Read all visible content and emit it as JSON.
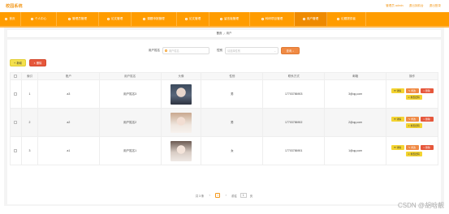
{
  "header": {
    "app_title": "校园系统",
    "links": [
      "管理员 admin",
      "退出到前台",
      "退出登录"
    ]
  },
  "nav": {
    "items": [
      "首页",
      "个人中心",
      "管理员管理",
      "论文管理",
      "课题申报管理",
      "论文管理",
      "留言板管理",
      "科研项目管理",
      "用户管理",
      "论题提供者"
    ],
    "active_index": 8
  },
  "breadcrumb": {
    "home": "首页",
    "separator": "/",
    "current": "用户"
  },
  "search": {
    "label_user": "用户姓名",
    "placeholder_user": "用户姓名",
    "label_gender": "性别",
    "placeholder_gender": "请选择性别",
    "search_button": "查询"
  },
  "actions": {
    "add": "新增",
    "delete": "删除"
  },
  "table": {
    "columns": [
      "",
      "索引",
      "账户",
      "用户姓名",
      "头像",
      "性别",
      "联系方式",
      "邮箱",
      "操作"
    ],
    "rows": [
      {
        "index": "1",
        "account": "a3",
        "name": "用户姓名3",
        "gender": "男",
        "phone": "17703786903",
        "email": "3@qq.com"
      },
      {
        "index": "2",
        "account": "a2",
        "name": "用户姓名2",
        "gender": "男",
        "phone": "17703786902",
        "email": "2@qq.com"
      },
      {
        "index": "3",
        "account": "a1",
        "name": "用户姓名1",
        "gender": "女",
        "phone": "17703786901",
        "email": "1@qq.com"
      }
    ],
    "op_labels": {
      "detail": "详情",
      "edit": "修改",
      "delete": "删除",
      "reset": "重置密码"
    }
  },
  "pager": {
    "total": "共 3 条",
    "page": "1",
    "goto_label": "前往",
    "goto_value": "1",
    "page_unit": "页"
  },
  "watermark": "CSDN @胡晗靓",
  "colors": {
    "accent": "#ff9c00",
    "search_btn": "#f08a44",
    "add_btn": "#f4e04d",
    "delete_btn": "#e6573b"
  }
}
